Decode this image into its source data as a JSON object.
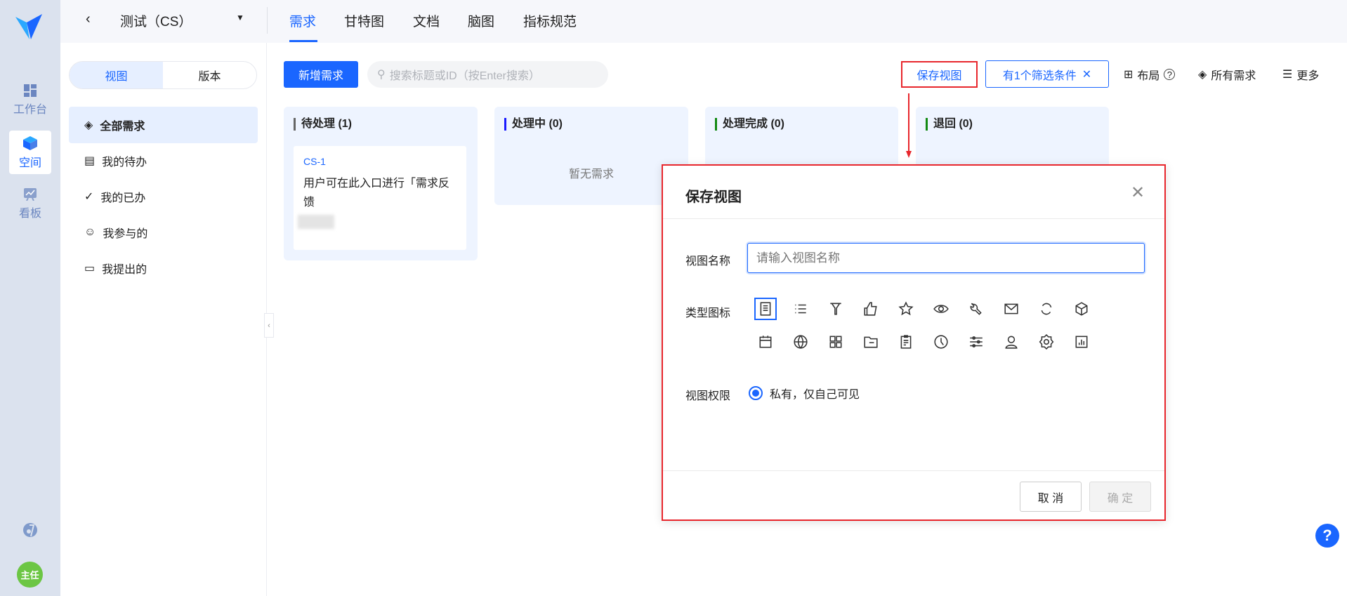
{
  "rail": {
    "items": [
      {
        "label": "工作台"
      },
      {
        "label": "空间"
      },
      {
        "label": "看板"
      }
    ],
    "avatar": "主任"
  },
  "header": {
    "project": "测试（CS）",
    "tabs": [
      "需求",
      "甘特图",
      "文档",
      "脑图",
      "指标规范"
    ],
    "active_tab": "需求"
  },
  "left": {
    "segments": [
      "视图",
      "版本"
    ],
    "menu": [
      "全部需求",
      "我的待办",
      "我的已办",
      "我参与的",
      "我提出的"
    ]
  },
  "toolbar": {
    "add": "新增需求",
    "search_placeholder": "搜索标题或ID（按Enter搜索）",
    "save_view": "保存视图",
    "filter": "有1个筛选条件",
    "layout": "布局",
    "all": "所有需求",
    "more": "更多"
  },
  "columns": [
    {
      "title": "待处理 (1)",
      "color": "#666666"
    },
    {
      "title": "处理中 (0)",
      "color": "#1a1aff",
      "empty": "暂无需求"
    },
    {
      "title": "处理完成 (0)",
      "color": "#138a13"
    },
    {
      "title": "退回 (0)",
      "color": "#138a13"
    }
  ],
  "card": {
    "id": "CS-1",
    "title": "用户可在此入口进行「需求反馈"
  },
  "dialog": {
    "title": "保存视图",
    "name_label": "视图名称",
    "name_placeholder": "请输入视图名称",
    "type_label": "类型图标",
    "perm_label": "视图权限",
    "perm_option": "私有，仅自己可见",
    "cancel": "取 消",
    "ok": "确 定",
    "icons": [
      "list-doc",
      "list",
      "filter",
      "thumb-up",
      "star",
      "eye",
      "wrench",
      "mail",
      "refresh",
      "cube",
      "calendar",
      "globe",
      "grid",
      "folder",
      "clipboard",
      "clock",
      "sliders",
      "user",
      "gear",
      "bar-chart"
    ]
  },
  "colors": {
    "accent": "#1a66ff",
    "highlight": "#e8262c"
  }
}
